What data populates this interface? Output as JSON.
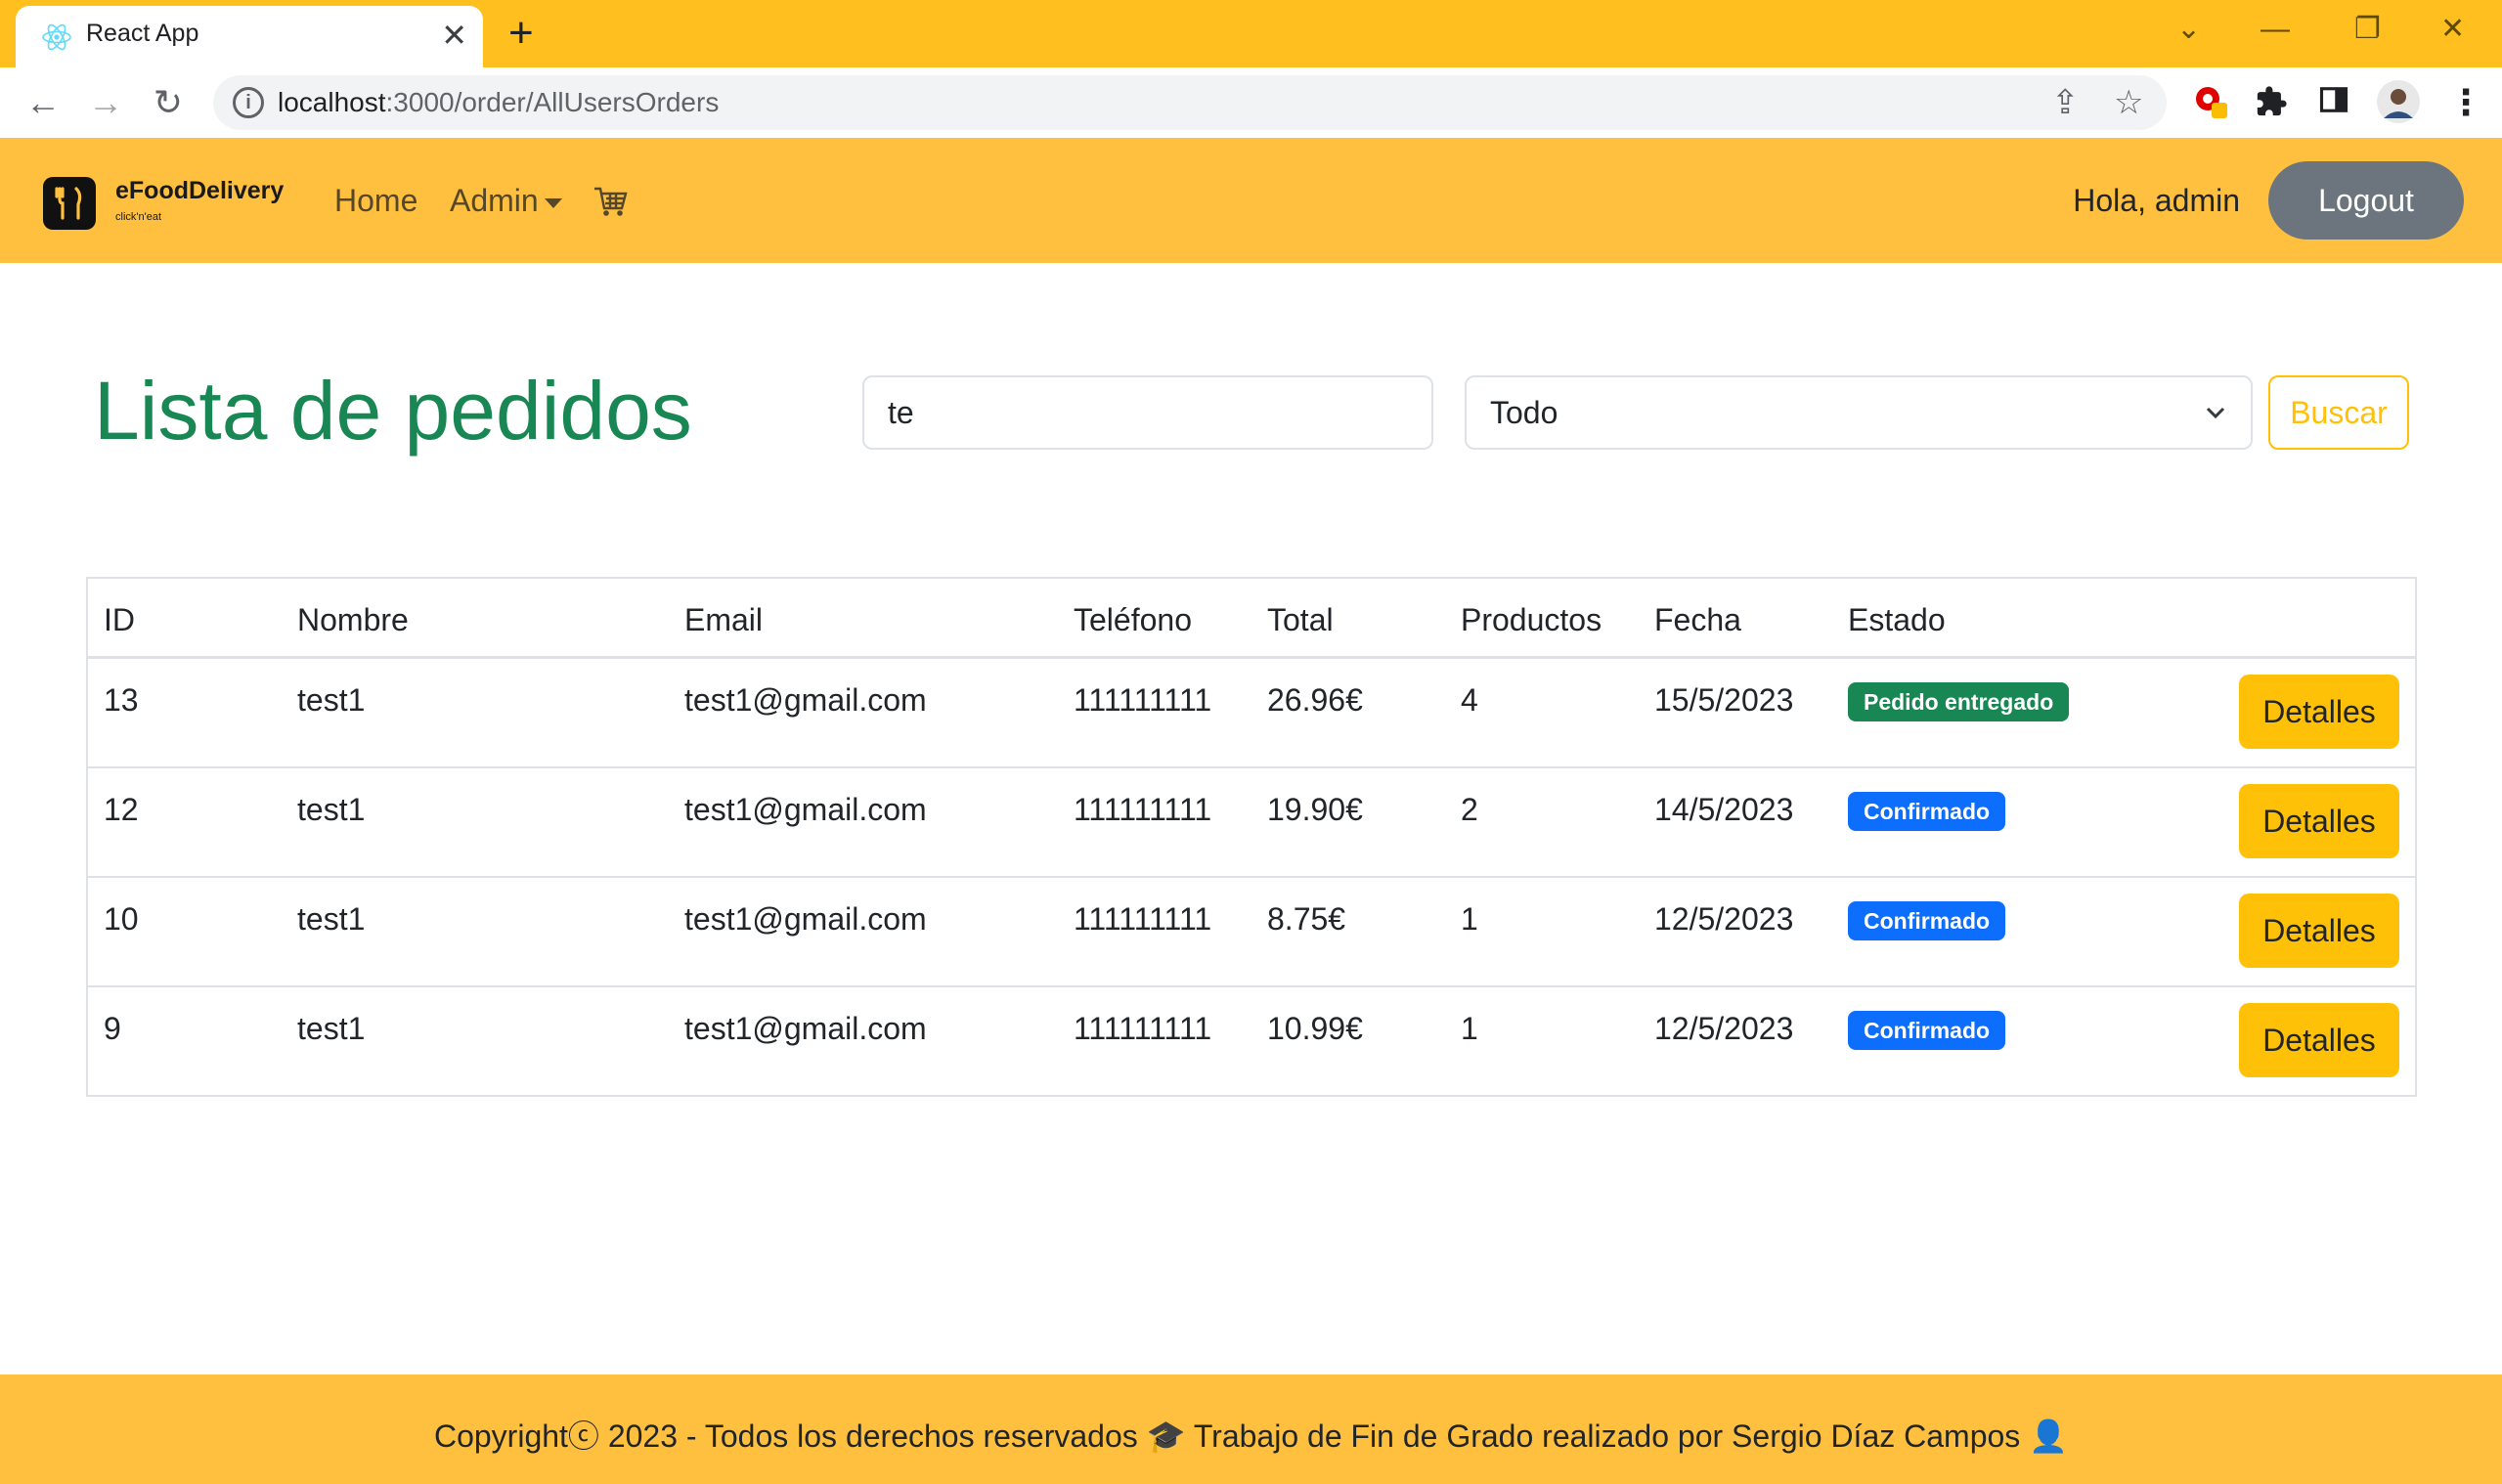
{
  "browser": {
    "tab_title": "React App",
    "tab_close": "✕",
    "new_tab": "+",
    "url_host": "localhost",
    "url_path": ":3000/order/AllUsersOrders",
    "window_controls": [
      "⌄",
      "—",
      "❐",
      "✕"
    ]
  },
  "navbar": {
    "brand_name": "eFoodDelivery",
    "brand_tagline": "click'n'eat",
    "home_label": "Home",
    "admin_label": "Admin",
    "greeting": "Hola, admin",
    "logout_label": "Logout"
  },
  "main": {
    "title": "Lista de pedidos",
    "search_value": "te",
    "filter_value": "Todo",
    "search_button": "Buscar"
  },
  "table": {
    "headers": [
      "ID",
      "Nombre",
      "Email",
      "Teléfono",
      "Total",
      "Productos",
      "Fecha",
      "Estado"
    ],
    "rows": [
      {
        "id": "13",
        "name": "test1",
        "email": "test1@gmail.com",
        "phone": "111111111",
        "total": "26.96€",
        "products": "4",
        "date": "15/5/2023",
        "status": "Pedido entregado",
        "action": "Detalles"
      },
      {
        "id": "12",
        "name": "test1",
        "email": "test1@gmail.com",
        "phone": "111111111",
        "total": "19.90€",
        "products": "2",
        "date": "14/5/2023",
        "status": "Confirmado",
        "action": "Detalles"
      },
      {
        "id": "10",
        "name": "test1",
        "email": "test1@gmail.com",
        "phone": "111111111",
        "total": "8.75€",
        "products": "1",
        "date": "12/5/2023",
        "status": "Confirmado",
        "action": "Detalles"
      },
      {
        "id": "9",
        "name": "test1",
        "email": "test1@gmail.com",
        "phone": "111111111",
        "total": "10.99€",
        "products": "1",
        "date": "12/5/2023",
        "status": "Confirmado",
        "action": "Detalles"
      }
    ]
  },
  "footer": {
    "text": "Copyrightⓒ 2023 - Todos los derechos reservados 🎓 Trabajo de Fin de Grado realizado por Sergio Díaz Campos 👤"
  },
  "colors": {
    "primary_yellow": "#ffbf3f",
    "title_green": "#198754",
    "badge_green": "#198754",
    "badge_blue": "#0d6efd",
    "button_yellow": "#ffc107",
    "logout_gray": "#6c757d"
  }
}
